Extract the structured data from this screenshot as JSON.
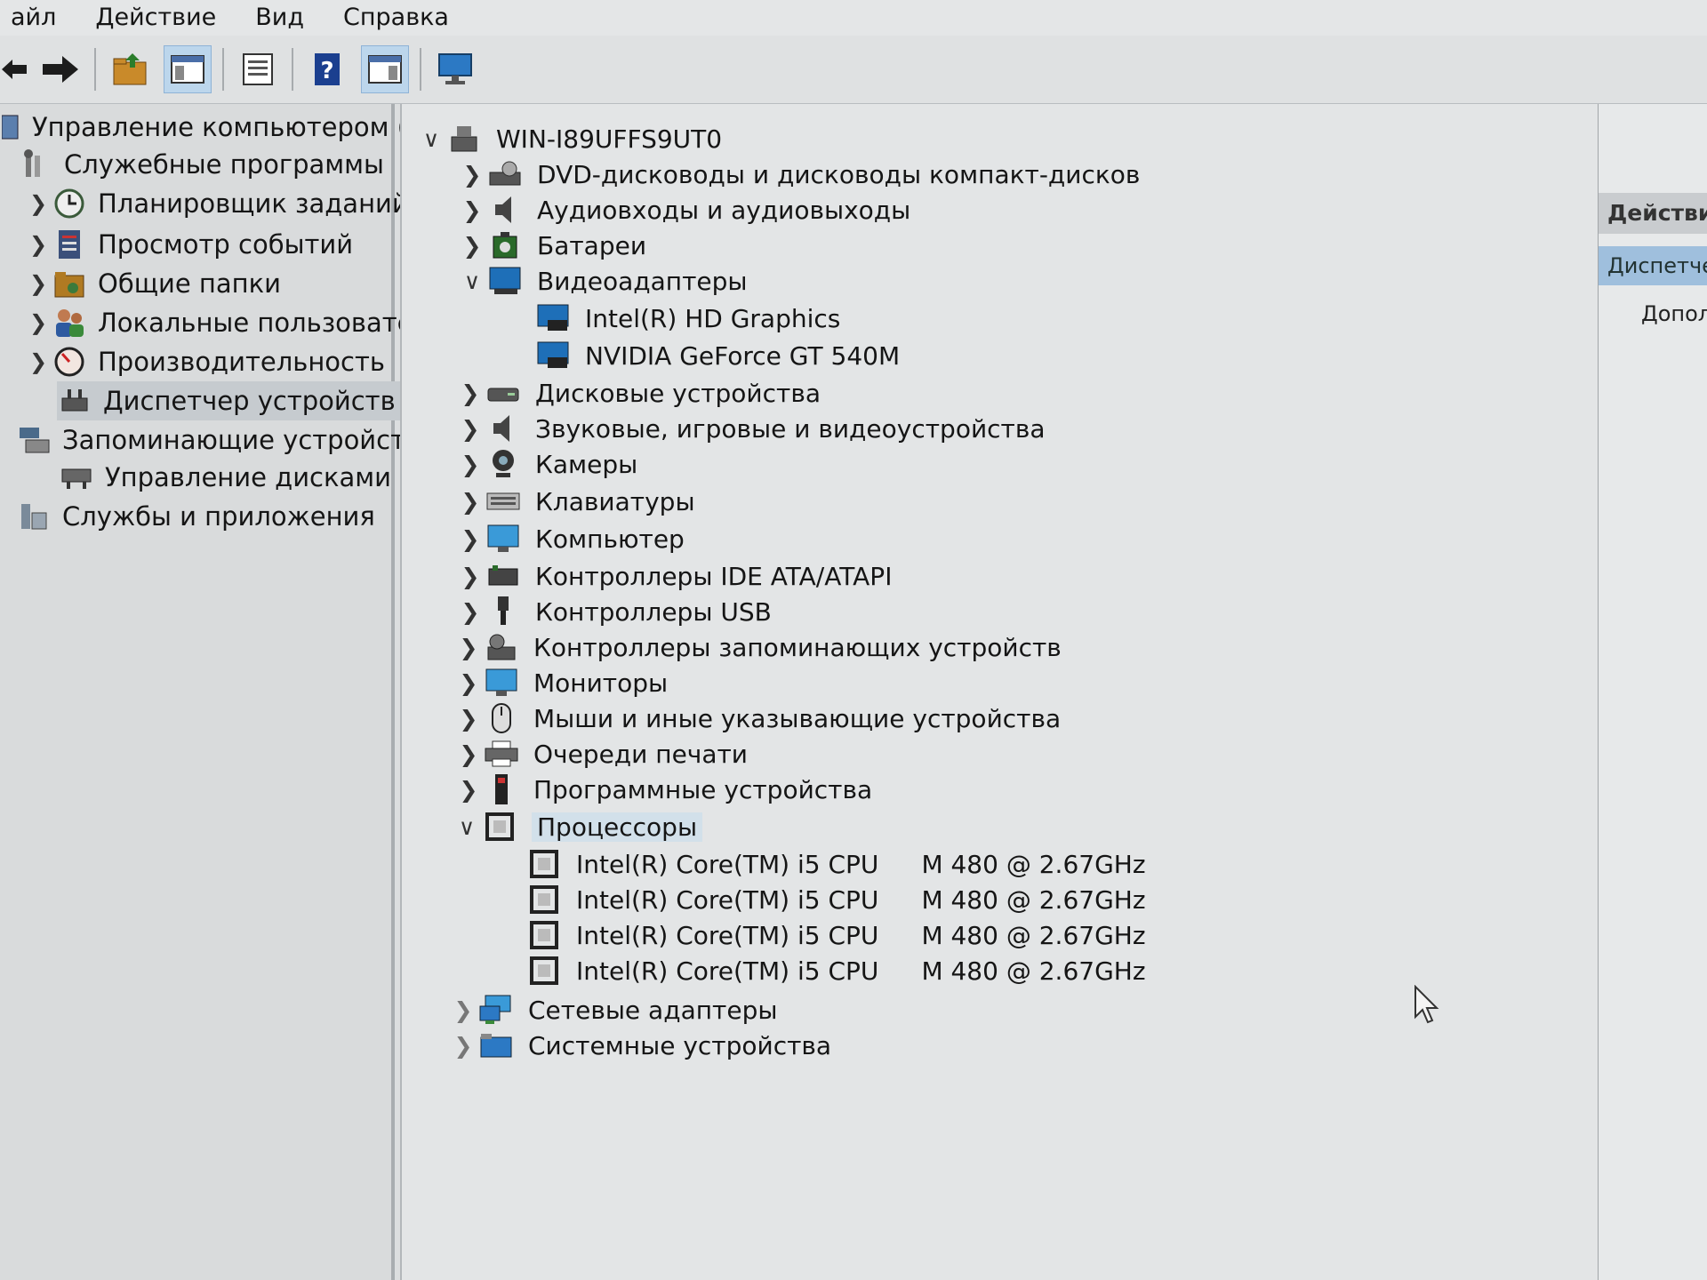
{
  "menubar": {
    "items": [
      "айл",
      "Действие",
      "Вид",
      "Справка"
    ]
  },
  "toolbar": {
    "buttons": [
      "back-icon",
      "forward-icon",
      "up-folder-icon",
      "show-hide-tree-icon",
      "properties-icon",
      "help-icon",
      "show-action-pane-icon",
      "monitor-icon"
    ]
  },
  "left_tree": {
    "root": "Управление компьютером (л",
    "system_tools": "Служебные программы",
    "task_scheduler": "Планировщик заданий",
    "event_viewer": "Просмотр событий",
    "shared_folders": "Общие папки",
    "local_users": "Локальные пользовате",
    "performance": "Производительность",
    "device_manager": "Диспетчер устройств",
    "storage": "Запоминающие устройст",
    "disk_management": "Управление дисками",
    "services_apps": "Службы и приложения"
  },
  "device_tree": {
    "computer_name": "WIN-I89UFFS9UT0",
    "categories": {
      "dvd": "DVD-дисководы и дисководы компакт-дисков",
      "audio_io": "Аудиовходы и аудиовыходы",
      "batteries": "Батареи",
      "display_adapters": "Видеоадаптеры",
      "disk_drives": "Дисковые устройства",
      "sound": "Звуковые, игровые и видеоустройства",
      "cameras": "Камеры",
      "keyboards": "Клавиатуры",
      "computer": "Компьютер",
      "ide": "Контроллеры IDE ATA/ATAPI",
      "usb": "Контроллеры USB",
      "storage_ctrl": "Контроллеры запоминающих устройств",
      "monitors": "Мониторы",
      "mice": "Мыши и иные указывающие устройства",
      "print_queues": "Очереди печати",
      "software_devices": "Программные устройства",
      "processors": "Процессоры",
      "network": "Сетевые адаптеры",
      "system": "Системные устройства"
    },
    "display_children": [
      "Intel(R) HD Graphics",
      "NVIDIA GeForce GT 540M"
    ],
    "cpus": [
      {
        "name": "Intel(R) Core(TM) i5 CPU",
        "detail": "M 480  @ 2.67GHz"
      },
      {
        "name": "Intel(R) Core(TM) i5 CPU",
        "detail": "M 480  @ 2.67GHz"
      },
      {
        "name": "Intel(R) Core(TM) i5 CPU",
        "detail": "M 480  @ 2.67GHz"
      },
      {
        "name": "Intel(R) Core(TM) i5 CPU",
        "detail": "M 480  @ 2.67GHz"
      }
    ]
  },
  "actions_pane": {
    "header": "Действия",
    "selected": "Диспетчер",
    "more": "Допол"
  },
  "colors": {
    "selection": "#d2e0ea",
    "left_selection": "#c6cbcf",
    "actions_selected": "#9fbfdd",
    "monitor_blue": "#1e6fb8"
  }
}
